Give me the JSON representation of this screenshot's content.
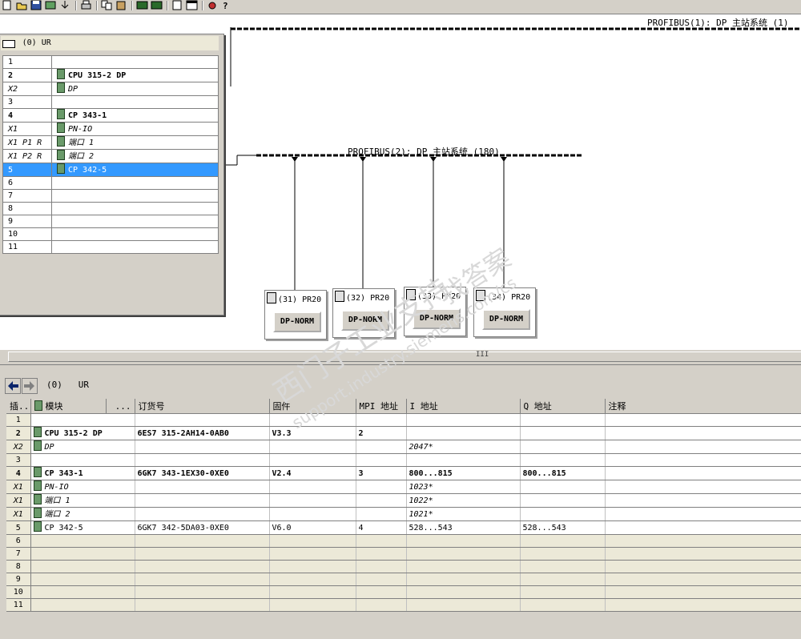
{
  "toolbar": {
    "icons": [
      "new-icon",
      "open-icon",
      "save-icon",
      "compile-icon",
      "download-icon",
      "print-icon",
      "copy-icon",
      "paste-icon",
      "catalog-icon",
      "netpro-icon",
      "module-icon",
      "window-icon",
      "network-icon",
      "help-icon"
    ]
  },
  "network": {
    "master1_label": "PROFIBUS(1): DP 主站系统 (1)",
    "master2_label": "PROFIBUS(2): DP 主站系统 (180)",
    "slaves": [
      {
        "label": "(31) PR20",
        "button": "DP-NORM"
      },
      {
        "label": "(32) PR20",
        "button": "DP-NORM"
      },
      {
        "label": "(33) PR20",
        "button": "DP-NORM"
      },
      {
        "label": "(34) PR20",
        "button": "DP-NORM"
      }
    ]
  },
  "rack": {
    "title": "(0) UR",
    "rows": [
      {
        "slot": "1",
        "name": "",
        "style": ""
      },
      {
        "slot": "2",
        "name": "CPU 315-2 DP",
        "style": "bold"
      },
      {
        "slot": "X2",
        "name": "DP",
        "style": "ital"
      },
      {
        "slot": "3",
        "name": "",
        "style": ""
      },
      {
        "slot": "4",
        "name": "CP 343-1",
        "style": "bold"
      },
      {
        "slot": "X1",
        "name": "PN-IO",
        "style": "ital"
      },
      {
        "slot": "X1 P1 R",
        "name": "端口 1",
        "style": "ital"
      },
      {
        "slot": "X1 P2 R",
        "name": "端口 2",
        "style": "ital"
      },
      {
        "slot": "5",
        "name": "CP 342-5",
        "style": "sel"
      },
      {
        "slot": "6",
        "name": "",
        "style": ""
      },
      {
        "slot": "7",
        "name": "",
        "style": ""
      },
      {
        "slot": "8",
        "name": "",
        "style": ""
      },
      {
        "slot": "9",
        "name": "",
        "style": ""
      },
      {
        "slot": "10",
        "name": "",
        "style": ""
      },
      {
        "slot": "11",
        "name": "",
        "style": ""
      }
    ]
  },
  "splitter": {
    "grip": "III"
  },
  "detail": {
    "title": "(0)   UR",
    "headers": [
      "插...",
      "模块",
      "...",
      "订货号",
      "固件",
      "MPI 地址",
      "I 地址",
      "Q 地址",
      "注释"
    ],
    "rows": [
      {
        "slot": "1",
        "module": "",
        "order": "",
        "fw": "",
        "mpi": "",
        "i": "",
        "q": "",
        "note": "",
        "style": ""
      },
      {
        "slot": "2",
        "module": "CPU 315-2 DP",
        "order": "6ES7 315-2AH14-0AB0",
        "fw": "V3.3",
        "mpi": "2",
        "i": "",
        "q": "",
        "note": "",
        "style": "bold"
      },
      {
        "slot": "X2",
        "module": "DP",
        "order": "",
        "fw": "",
        "mpi": "",
        "i": "2047*",
        "q": "",
        "note": "",
        "style": "ital"
      },
      {
        "slot": "3",
        "module": "",
        "order": "",
        "fw": "",
        "mpi": "",
        "i": "",
        "q": "",
        "note": "",
        "style": ""
      },
      {
        "slot": "4",
        "module": "CP 343-1",
        "order": "6GK7 343-1EX30-0XE0",
        "fw": "V2.4",
        "mpi": "3",
        "i": "800...815",
        "q": "800...815",
        "note": "",
        "style": "bold"
      },
      {
        "slot": "X1",
        "module": "PN-IO",
        "order": "",
        "fw": "",
        "mpi": "",
        "i": "1023*",
        "q": "",
        "note": "",
        "style": "ital"
      },
      {
        "slot": "X1",
        "module": "端口 1",
        "order": "",
        "fw": "",
        "mpi": "",
        "i": "1022*",
        "q": "",
        "note": "",
        "style": "ital"
      },
      {
        "slot": "X1",
        "module": "端口 2",
        "order": "",
        "fw": "",
        "mpi": "",
        "i": "1021*",
        "q": "",
        "note": "",
        "style": "ital"
      },
      {
        "slot": "5",
        "module": "CP 342-5",
        "order": "6GK7 342-5DA03-0XE0",
        "fw": "V6.0",
        "mpi": "4",
        "i": "528...543",
        "q": "528...543",
        "note": "",
        "style": ""
      },
      {
        "slot": "6",
        "module": "",
        "order": "",
        "fw": "",
        "mpi": "",
        "i": "",
        "q": "",
        "note": "",
        "style": "gray"
      },
      {
        "slot": "7",
        "module": "",
        "order": "",
        "fw": "",
        "mpi": "",
        "i": "",
        "q": "",
        "note": "",
        "style": "gray"
      },
      {
        "slot": "8",
        "module": "",
        "order": "",
        "fw": "",
        "mpi": "",
        "i": "",
        "q": "",
        "note": "",
        "style": "gray"
      },
      {
        "slot": "9",
        "module": "",
        "order": "",
        "fw": "",
        "mpi": "",
        "i": "",
        "q": "",
        "note": "",
        "style": "gray"
      },
      {
        "slot": "10",
        "module": "",
        "order": "",
        "fw": "",
        "mpi": "",
        "i": "",
        "q": "",
        "note": "",
        "style": "gray"
      },
      {
        "slot": "11",
        "module": "",
        "order": "",
        "fw": "",
        "mpi": "",
        "i": "",
        "q": "",
        "note": "",
        "style": "gray"
      }
    ]
  },
  "watermark": {
    "cn": "西门子工业支持",
    "cn2": "找答案",
    "url": "support.industry.siemens.com/cs"
  }
}
